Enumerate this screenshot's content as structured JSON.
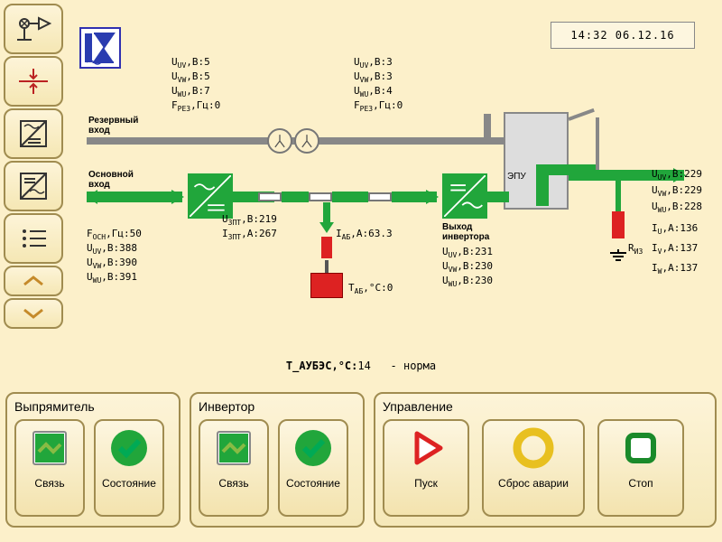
{
  "datetime": "14:32 06.12.16",
  "reserve_label": "Резервный\nвход",
  "main_label": "Основной\nвход",
  "reserve_in": {
    "U_UV": "5",
    "U_VW": "5",
    "U_WU": "7",
    "F_RES": "0"
  },
  "reserve_mid": {
    "U_UV": "3",
    "U_VW": "3",
    "U_WU": "4",
    "F_RES": "0"
  },
  "main_in": {
    "F_OSN": "50",
    "U_UV": "388",
    "U_VW": "390",
    "U_WU": "391"
  },
  "zpt": {
    "U_ZPT": "219",
    "I_ZPT": "267"
  },
  "bat": {
    "I_AB": "63.3",
    "T_AB": "0"
  },
  "inverter_out_label": "Выход\nинвертора",
  "inverter_out": {
    "U_UV": "231",
    "U_VW": "230",
    "U_WU": "230"
  },
  "output": {
    "U_UV": "229",
    "U_VW": "229",
    "U_WU": "228",
    "I_U": "136",
    "I_V": "137",
    "I_W": "137"
  },
  "epu_label": "ЭПУ",
  "riz_label": "R_ИЗ",
  "temp_line": {
    "label": "T_АУБЭС,°C:",
    "value": "14",
    "status": "- норма"
  },
  "panels": {
    "rectifier": {
      "title": "Выпрямитель",
      "link": "Связь",
      "state": "Состояние"
    },
    "inverter": {
      "title": "Инвертор",
      "link": "Связь",
      "state": "Состояние"
    },
    "control": {
      "title": "Управление",
      "start": "Пуск",
      "reset": "Сброс аварии",
      "stop": "Стоп"
    }
  }
}
